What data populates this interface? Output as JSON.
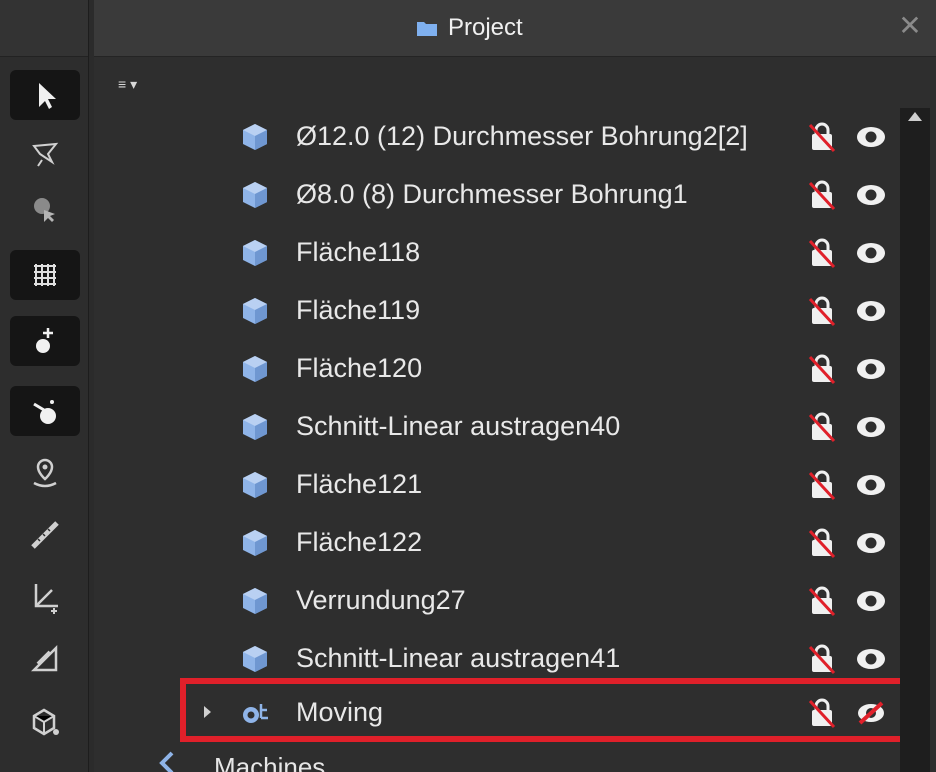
{
  "panel": {
    "title": "Project",
    "close_glyph": "✕",
    "menu_glyph": "≡",
    "menu_arrow": "▾"
  },
  "toolbar": {
    "items": [
      {
        "icon": "select-arrow-icon",
        "active": true
      },
      {
        "icon": "lasso-select-icon",
        "active": false
      },
      {
        "icon": "object-select-icon",
        "active": false
      },
      {
        "icon": "grid-icon",
        "active": true
      },
      {
        "icon": "snap-point-icon",
        "active": true
      },
      {
        "icon": "snap-move-icon",
        "active": true
      },
      {
        "icon": "location-pin-icon",
        "active": false
      },
      {
        "icon": "ruler-icon",
        "active": false
      },
      {
        "icon": "axis-icon",
        "active": false
      },
      {
        "icon": "angle-measure-icon",
        "active": false
      },
      {
        "icon": "solid-view-icon",
        "active": false
      }
    ]
  },
  "tree": {
    "items": [
      {
        "label": "Ø12.0 (12) Durchmesser Bohrung2[2]"
      },
      {
        "label": "Ø8.0 (8) Durchmesser Bohrung1"
      },
      {
        "label": "Fläche118"
      },
      {
        "label": "Fläche119"
      },
      {
        "label": "Fläche120"
      },
      {
        "label": "Schnitt-Linear austragen40"
      },
      {
        "label": "Fläche121"
      },
      {
        "label": "Fläche122"
      },
      {
        "label": "Verrundung27"
      },
      {
        "label": "Schnitt-Linear austragen41"
      }
    ],
    "moving": {
      "label": "Moving"
    },
    "machines": {
      "label": "Machines"
    }
  },
  "colors": {
    "accent_highlight": "#e0202a",
    "cube": "#8fb4e8",
    "folder": "#7fb0ef"
  }
}
